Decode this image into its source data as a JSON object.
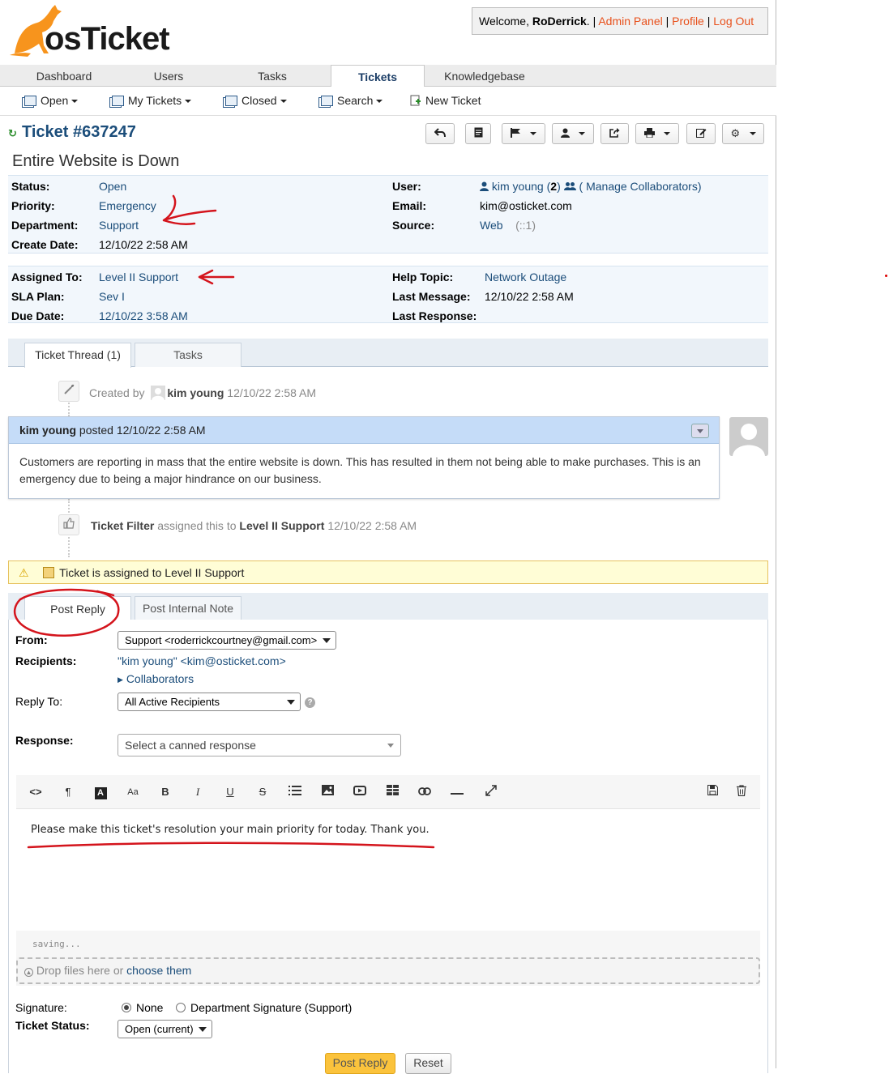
{
  "header": {
    "logo_text": "osTicket",
    "welcome_prefix": "Welcome, ",
    "username": "RoDerrick",
    "sep": ". | ",
    "admin_panel": "Admin Panel",
    "profile": "Profile",
    "logout": "Log Out",
    "pipe": " | "
  },
  "nav": {
    "tabs": [
      {
        "label": "Dashboard"
      },
      {
        "label": "Users"
      },
      {
        "label": "Tasks"
      },
      {
        "label": "Tickets"
      },
      {
        "label": "Knowledgebase"
      }
    ]
  },
  "subnav": {
    "open": "Open",
    "my_tickets": "My Tickets",
    "closed": "Closed",
    "search": "Search",
    "new_ticket": "New Ticket"
  },
  "ticket": {
    "number": "Ticket #637247",
    "subject": "Entire Website is Down"
  },
  "info": {
    "status_label": "Status:",
    "status": "Open",
    "priority_label": "Priority:",
    "priority": "Emergency",
    "department_label": "Department:",
    "department": "Support",
    "create_label": "Create Date:",
    "create_date": "12/10/22 2:58 AM",
    "user_label": "User:",
    "user": "kim young",
    "user_count": "2",
    "manage_collab": "Manage Collaborators",
    "email_label": "Email:",
    "email": "kim@osticket.com",
    "source_label": "Source:",
    "source": "Web",
    "source_ip": "(::1)",
    "assigned_label": "Assigned To:",
    "assigned": "Level II Support",
    "sla_label": "SLA Plan:",
    "sla": "Sev I",
    "due_label": "Due Date:",
    "due_date": "12/10/22 3:58 AM",
    "topic_label": "Help Topic:",
    "topic": "Network Outage",
    "lastmsg_label": "Last Message:",
    "last_message": "12/10/22 2:58 AM",
    "lastresp_label": "Last Response:"
  },
  "thread_tabs": {
    "thread": "Ticket Thread (1)",
    "tasks": "Tasks"
  },
  "thread": {
    "created_by": "Created by",
    "created_user": "kim young",
    "created_time": "12/10/22 2:58 AM",
    "msg_author": "kim young",
    "msg_posted": "posted",
    "msg_time": "12/10/22 2:58 AM",
    "msg_body": "Customers are reporting in mass that the entire website is down. This has resulted in them not being able to make purchases. This is an emergency due to being a major hindrance on our business.",
    "filter_name": "Ticket Filter",
    "filter_action": "assigned this to",
    "filter_target": "Level II Support",
    "filter_time": "12/10/22 2:58 AM",
    "alert": "Ticket is assigned to Level II Support"
  },
  "reply": {
    "tab_post": "Post Reply",
    "tab_note": "Post Internal Note",
    "from_label": "From:",
    "from_value": "Support <roderrickcourtney@gmail.com>",
    "recipients_label": "Recipients:",
    "recipient": "\"kim young\" <kim@osticket.com>",
    "collaborators": "Collaborators",
    "replyto_label": "Reply To:",
    "replyto_value": "All Active Recipients",
    "response_label": "Response:",
    "response_placeholder": "Select a canned response",
    "editor_text": "Please make this ticket's resolution your main priority for today. Thank you.",
    "saving": "saving...",
    "drop_text": "Drop files here or ",
    "drop_link": "choose them",
    "signature_label": "Signature:",
    "sig_none": "None",
    "sig_dept": "Department Signature (Support)",
    "status_label": "Ticket Status:",
    "status_value": "Open (current)",
    "post_button": "Post Reply",
    "reset_button": "Reset"
  },
  "colors": {
    "accent": "#1b4d7a",
    "link_orange": "#e8501b",
    "annotation_red": "#d4141c",
    "message_header": "#c5dcf8",
    "post_button": "#fbc33c"
  }
}
